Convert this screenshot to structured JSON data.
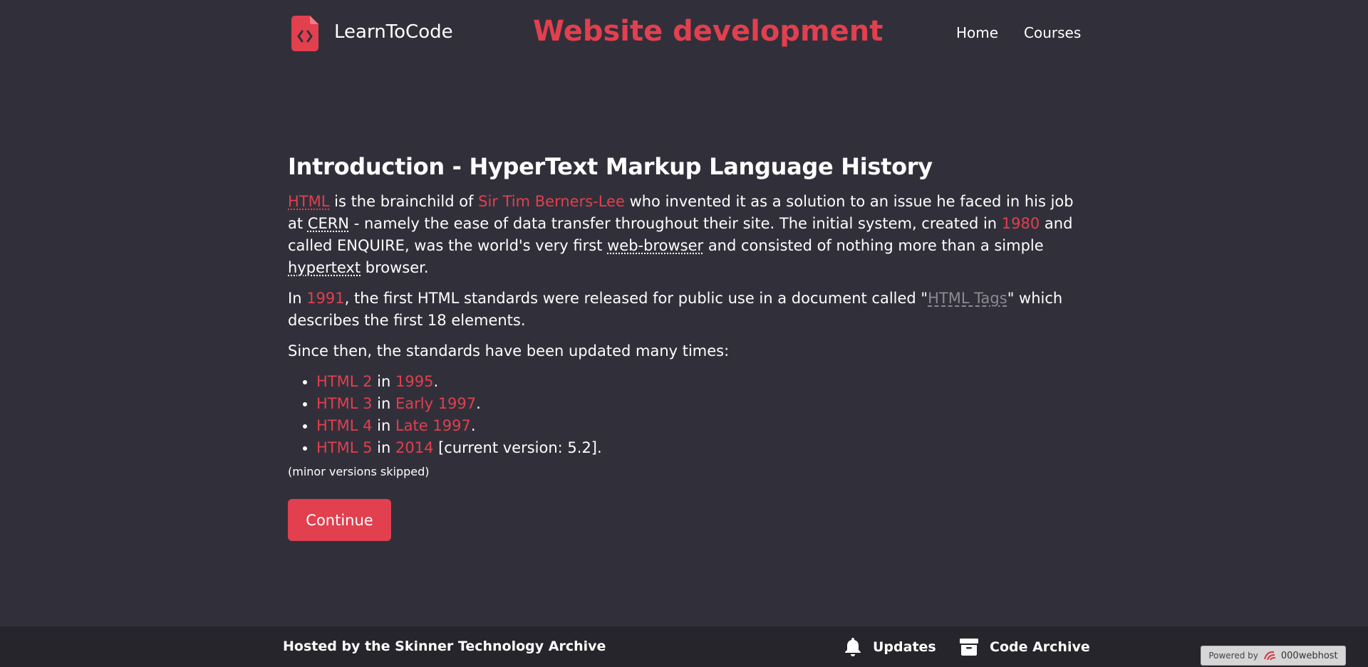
{
  "header": {
    "brand": "LearnToCode",
    "title": "Website development",
    "nav": [
      "Home",
      "Courses"
    ],
    "logo_icon": "code-file-icon"
  },
  "article": {
    "heading": "Introduction - HyperText Markup Language History",
    "p1": {
      "html": "HTML",
      "t1": " is the brainchild of ",
      "person": "Sir Tim Berners-Lee",
      "t2": " who invented it as a solution to an issue he faced in his job at ",
      "cern": "CERN",
      "t3": " - namely the ease of data transfer throughout their site. The initial system, created in ",
      "year": "1980",
      "t4": " and called ENQUIRE, was the world's very first ",
      "browser": "web-browser",
      "t5": " and consisted of nothing more than a simple ",
      "hypertext": "hypertext",
      "t6": " browser."
    },
    "p2": {
      "t1": "In ",
      "year": "1991",
      "t2": ", the first HTML standards were released for public use in a document called \"",
      "doc": "HTML Tags",
      "t3": "\" which describes the first 18 elements."
    },
    "p3": "Since then, the standards have been updated many times:",
    "versions": [
      {
        "name": "HTML 2",
        "in": " in ",
        "date": "1995",
        "suffix": "."
      },
      {
        "name": "HTML 3",
        "in": " in ",
        "date": "Early 1997",
        "suffix": "."
      },
      {
        "name": "HTML 4",
        "in": " in ",
        "date": "Late 1997",
        "suffix": "."
      },
      {
        "name": "HTML 5",
        "in": " in ",
        "date": "2014",
        "suffix": " [current version: 5.2]."
      }
    ],
    "note": "(minor versions skipped)",
    "continue": "Continue"
  },
  "footer": {
    "hosted": "Hosted by the Skinner Technology Archive",
    "updates": "Updates",
    "archive": "Code Archive",
    "powered_by": "Powered by",
    "host": "000webhost"
  },
  "colors": {
    "background": "#31303a",
    "footer": "#25252b",
    "accent": "#e23f4f"
  }
}
